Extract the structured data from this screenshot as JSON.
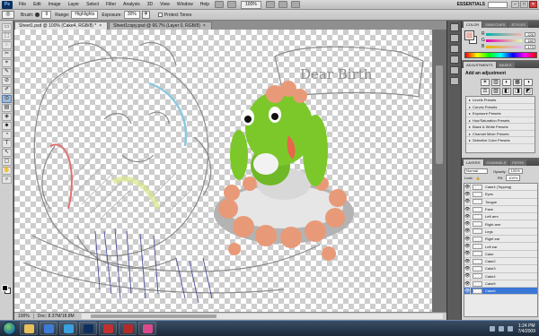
{
  "app": {
    "logo_text": "Ps",
    "menu": [
      "File",
      "Edit",
      "Image",
      "Layer",
      "Select",
      "Filter",
      "Analysis",
      "3D",
      "View",
      "Window",
      "Help"
    ],
    "zoom_select": "100%",
    "workspace": "ESSENTIALS",
    "window_controls": [
      "–",
      "□",
      "✕"
    ]
  },
  "options_bar": {
    "brush_label": "Brush:",
    "brush_size": "9",
    "range_label": "Range:",
    "range_value": "Highlights",
    "exposure_label": "Exposure:",
    "exposure_value": "30%",
    "protect_tones_label": "Protect Tones"
  },
  "tools": [
    "▭",
    "⬚",
    "◌",
    "✂",
    "⌖",
    "✎",
    "⊘",
    "✐",
    "⊙",
    "▤",
    "◈",
    "⬥",
    "◔",
    "T",
    "↖",
    "▢",
    "✋",
    "⌕"
  ],
  "document_tabs": [
    {
      "label": "Sheet1.psd @ 100% (Cake4, RGB/8) *",
      "active": true
    },
    {
      "label": "Sheet1copy.psd @ 66.7% (Layer 0, RGB/8)",
      "active": false
    }
  ],
  "canvas": {
    "banner_text": "Dear Birth",
    "colors": {
      "green": "#7cc82b",
      "frosting": "#e89a78",
      "sketch": "#8a8a8a"
    }
  },
  "status": {
    "zoom": "100%",
    "doc": "Doc: 8.37M/18.8M"
  },
  "color_panel": {
    "tabs": [
      "COLOR",
      "SWATCHES",
      "STYLES"
    ],
    "fg_color": "#e2b4ad",
    "sliders": [
      {
        "letter": "R",
        "value": "226"
      },
      {
        "letter": "G",
        "value": "180"
      },
      {
        "letter": "B",
        "value": "173"
      }
    ]
  },
  "adjustments_panel": {
    "tabs": [
      "ADJUSTMENTS",
      "MASKS"
    ],
    "title": "Add an adjustment",
    "icons": [
      "☀",
      "▥",
      "◐",
      "▦",
      "◑",
      "⚖",
      "▨",
      "◧",
      "◨",
      "◩",
      "◪",
      "▩"
    ],
    "presets": [
      "Levels Presets",
      "Curves Presets",
      "Exposure Presets",
      "Hue/Saturation Presets",
      "Black & White Presets",
      "Channel Mixer Presets",
      "Selective Color Presets"
    ]
  },
  "layers_panel": {
    "tabs": [
      "LAYERS",
      "CHANNELS",
      "PATHS"
    ],
    "blend_mode": "Normal",
    "opacity_label": "Opacity:",
    "opacity_value": "100%",
    "lock_label": "Lock:",
    "fill_label": "Fill:",
    "fill_value": "100%",
    "layers": [
      "Cake4 (Topping)",
      "Eyes",
      "Tongue",
      "Face",
      "Left arm",
      "Right arm",
      "Legs",
      "Right ear",
      "Left ear",
      "Cake",
      "Cake2",
      "Cake3",
      "Cake4",
      "Cake5",
      "Cake6"
    ],
    "selected_index": 14
  },
  "taskbar": {
    "time": "1:24 PM",
    "date": "7/4/2009"
  }
}
